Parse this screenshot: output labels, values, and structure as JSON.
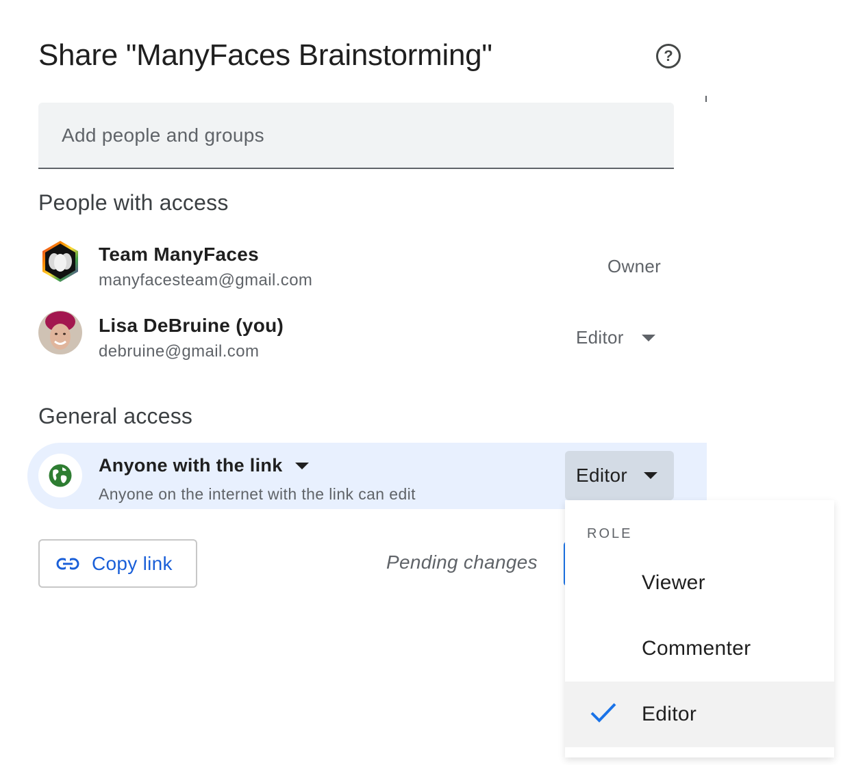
{
  "dialog": {
    "title": "Share \"ManyFaces Brainstorming\"",
    "help_icon": "help-circle-icon",
    "help_glyph": "?"
  },
  "add_people": {
    "placeholder": "Add people and groups"
  },
  "people_section": {
    "heading": "People with access",
    "people": [
      {
        "name": "Team ManyFaces",
        "email": "manyfacesteam@gmail.com",
        "role": "Owner"
      },
      {
        "name": "Lisa DeBruine (you)",
        "email": "debruine@gmail.com",
        "role": "Editor"
      }
    ]
  },
  "general_access": {
    "heading": "General access",
    "link_type": "Anyone with the link",
    "description": "Anyone on the internet with the link can edit",
    "role": "Editor",
    "icon": "globe-icon"
  },
  "footer": {
    "copy_link": "Copy link",
    "copy_icon": "link-icon",
    "pending": "Pending changes"
  },
  "role_menu": {
    "label": "ROLE",
    "items": [
      {
        "label": "Viewer",
        "selected": false
      },
      {
        "label": "Commenter",
        "selected": false
      },
      {
        "label": "Editor",
        "selected": true
      }
    ]
  },
  "colors": {
    "accent_blue": "#1a73e8",
    "link_blue": "#1a5fd8",
    "access_row_bg": "#e8f0fe",
    "globe_green": "#2e7d32"
  }
}
